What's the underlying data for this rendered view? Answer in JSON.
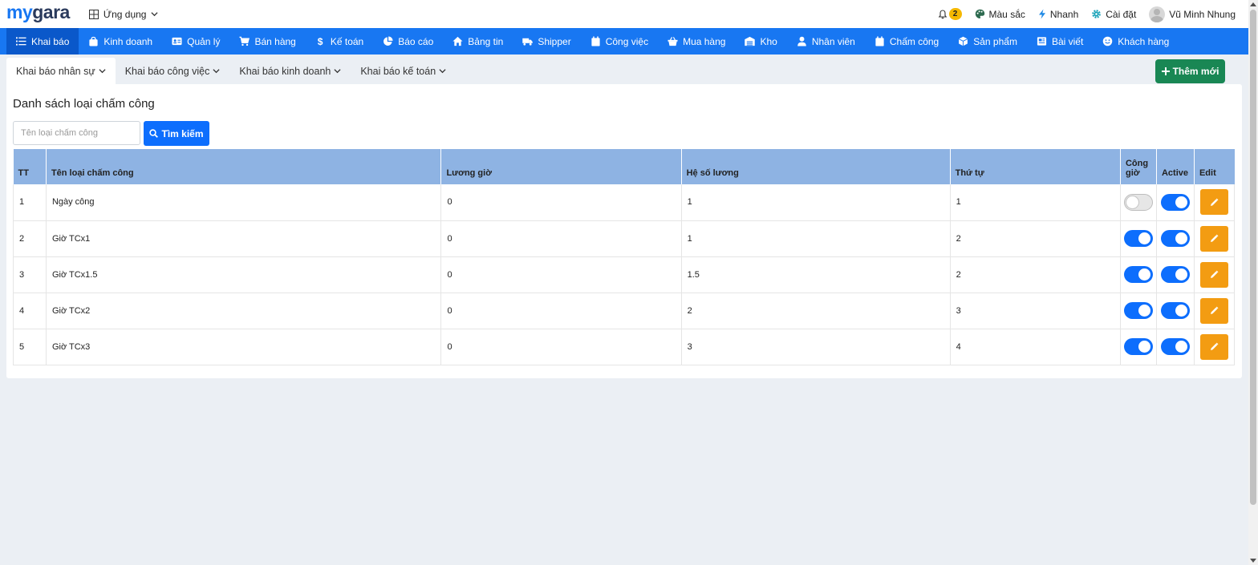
{
  "app": {
    "logo_part1": "my",
    "logo_part2": "gara",
    "apps_label": "Ứng dụng"
  },
  "topbar": {
    "notification_count": "2",
    "color_label": "Màu sắc",
    "quick_label": "Nhanh",
    "settings_label": "Cài đặt",
    "user_name": "Vũ Minh Nhung"
  },
  "nav": [
    {
      "label": "Khai báo",
      "icon": "list-icon"
    },
    {
      "label": "Kinh doanh",
      "icon": "bag-icon"
    },
    {
      "label": "Quản lý",
      "icon": "id-card-icon"
    },
    {
      "label": "Bán hàng",
      "icon": "cart-icon"
    },
    {
      "label": "Kế toán",
      "icon": "dollar-icon"
    },
    {
      "label": "Báo cáo",
      "icon": "pie-chart-icon"
    },
    {
      "label": "Bảng tin",
      "icon": "home-icon"
    },
    {
      "label": "Shipper",
      "icon": "truck-icon"
    },
    {
      "label": "Công việc",
      "icon": "calendar-icon"
    },
    {
      "label": "Mua hàng",
      "icon": "basket-icon"
    },
    {
      "label": "Kho",
      "icon": "warehouse-icon"
    },
    {
      "label": "Nhân viên",
      "icon": "user-icon"
    },
    {
      "label": "Chấm công",
      "icon": "calendar-check-icon"
    },
    {
      "label": "Sản phẩm",
      "icon": "box-icon"
    },
    {
      "label": "Bài viết",
      "icon": "newspaper-icon"
    },
    {
      "label": "Khách hàng",
      "icon": "smile-icon"
    }
  ],
  "subtabs": [
    "Khai báo nhân sự",
    "Khai báo công việc",
    "Khai báo kinh doanh",
    "Khai báo kế toán"
  ],
  "add_button": "Thêm mới",
  "page": {
    "title": "Danh sách loại chấm công",
    "search_placeholder": "Tên loại chấm công",
    "search_button": "Tìm kiếm"
  },
  "table": {
    "columns": [
      "TT",
      "Tên loại chấm công",
      "Lương giờ",
      "Hệ số lương",
      "Thứ tự",
      "Công giờ",
      "Active",
      "Edit"
    ],
    "rows": [
      {
        "tt": "1",
        "name": "Ngày công",
        "luong_gio": "0",
        "he_so": "1",
        "thu_tu": "1",
        "cong_gio": false,
        "active": true
      },
      {
        "tt": "2",
        "name": "Giờ TCx1",
        "luong_gio": "0",
        "he_so": "1",
        "thu_tu": "2",
        "cong_gio": true,
        "active": true
      },
      {
        "tt": "3",
        "name": "Giờ TCx1.5",
        "luong_gio": "0",
        "he_so": "1.5",
        "thu_tu": "2",
        "cong_gio": true,
        "active": true
      },
      {
        "tt": "4",
        "name": "Giờ TCx2",
        "luong_gio": "0",
        "he_so": "2",
        "thu_tu": "3",
        "cong_gio": true,
        "active": true
      },
      {
        "tt": "5",
        "name": "Giờ TCx3",
        "luong_gio": "0",
        "he_so": "3",
        "thu_tu": "4",
        "cong_gio": true,
        "active": true
      }
    ]
  },
  "colors": {
    "primary": "#1877f2",
    "success": "#198754",
    "warning": "#f39c12",
    "table_header": "#8eb3e3"
  }
}
